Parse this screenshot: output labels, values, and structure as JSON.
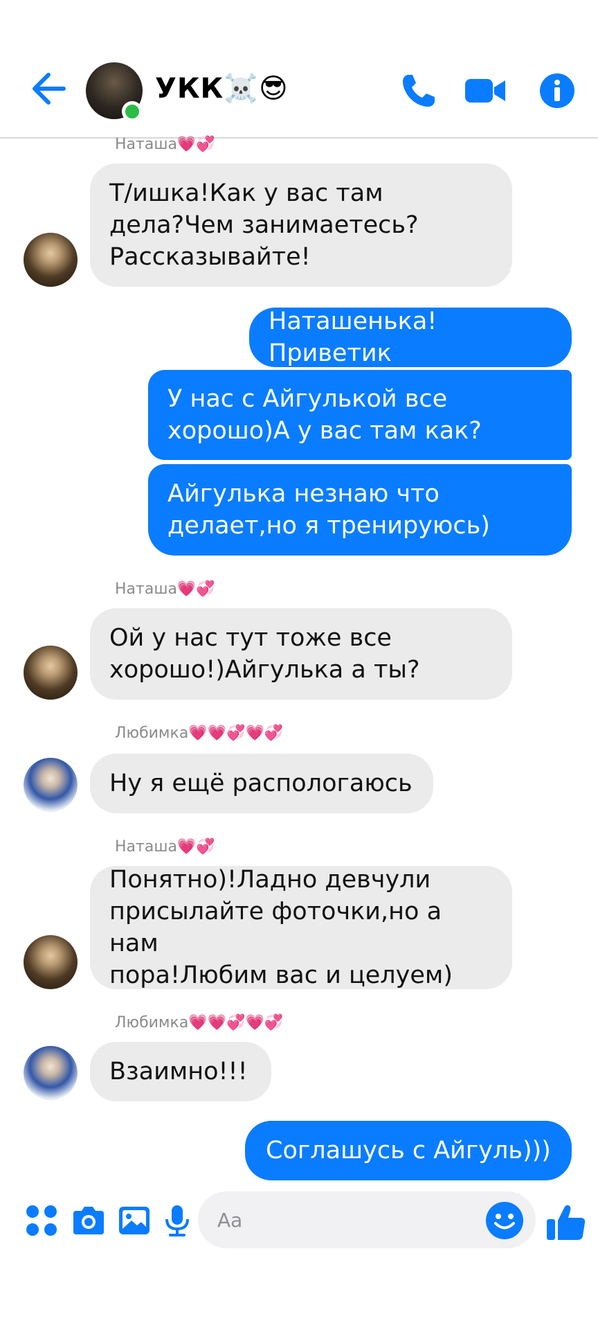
{
  "header": {
    "title": "УКК☠️😎",
    "back_icon": "arrow-left-icon",
    "call_icon": "phone-icon",
    "video_icon": "video-camera-icon",
    "info_icon": "info-icon"
  },
  "messages": [
    {
      "sender": "Наташа💗💞",
      "text_lines": [
        "Т/ишка!Как у вас там",
        "дела?Чем занимаетесь?",
        "Рассказывайте!"
      ],
      "direction": "in"
    },
    {
      "text_lines": [
        "Наташенька!Приветик"
      ],
      "direction": "out"
    },
    {
      "text_lines": [
        "У нас с Айгулькой все",
        "хорошо)А у вас там как?"
      ],
      "direction": "out"
    },
    {
      "text_lines": [
        "Айгулька незнаю что",
        "делает,но я тренируюсь)"
      ],
      "direction": "out"
    },
    {
      "sender": "Наташа💗💞",
      "text_lines": [
        "Ой у нас тут тоже все",
        "хорошо!)Айгулька а ты?"
      ],
      "direction": "in"
    },
    {
      "sender": "Любимка💗💗💞💗💞",
      "text_lines": [
        "Ну я ещё распологаюсь"
      ],
      "direction": "in"
    },
    {
      "sender": "Наташа💗💞",
      "text_lines": [
        "Понятно)!Ладно девчули",
        "присылайте фоточки,но а нам",
        "пора!Любим вас и целуем)"
      ],
      "direction": "in"
    },
    {
      "sender": "Любимка💗💗💞💗💞",
      "text_lines": [
        "Взаимно!!!"
      ],
      "direction": "in"
    },
    {
      "text_lines": [
        "Соглашусь с Айгуль)))"
      ],
      "direction": "out"
    }
  ],
  "composer": {
    "placeholder": "Aa",
    "icons": [
      "grid-menu-icon",
      "camera-icon",
      "image-icon",
      "microphone-icon",
      "smile-emoji-icon",
      "thumbs-up-icon"
    ]
  },
  "colors": {
    "accent": "#0a7cff",
    "incoming_bubble": "#ebebeb",
    "online": "#2bbd46"
  }
}
